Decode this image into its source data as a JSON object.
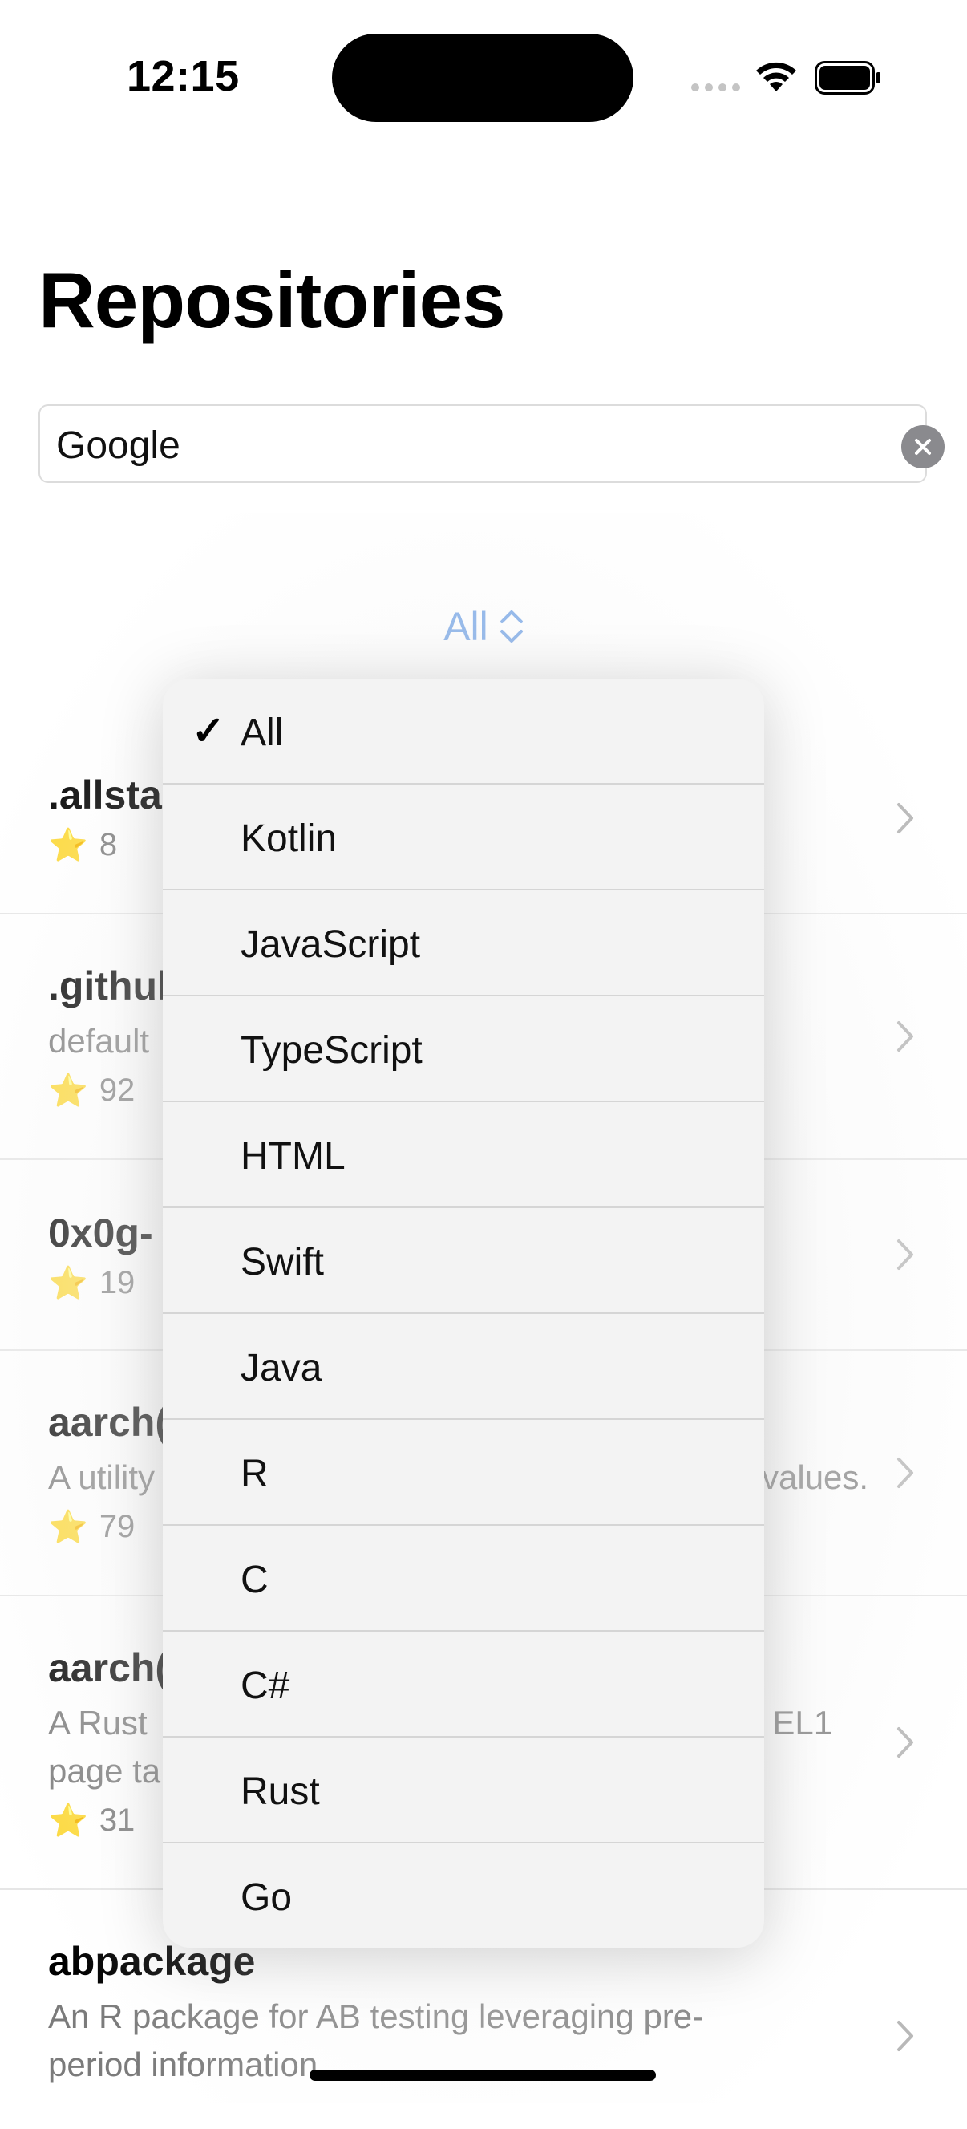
{
  "status": {
    "time": "12:15"
  },
  "page": {
    "title": "Repositories"
  },
  "search": {
    "value": "Google"
  },
  "filter": {
    "selected": "All"
  },
  "repos": [
    {
      "name": ".allsta",
      "description": "",
      "stars": "8"
    },
    {
      "name": ".githul",
      "description": "default",
      "stars": "92"
    },
    {
      "name": "0x0g-",
      "description": "",
      "stars": "19"
    },
    {
      "name": "aarch(",
      "description": "A utility",
      "description_tail": "values.",
      "stars": "79"
    },
    {
      "name": "aarch(",
      "description": "A Rust",
      "description_tail": ". EL1",
      "description_line2": "page ta",
      "stars": "31"
    },
    {
      "name": "abpackage",
      "description": "An R package for AB testing leveraging pre-",
      "description_line2": "period information"
    }
  ],
  "menu": {
    "items": [
      "All",
      "Kotlin",
      "JavaScript",
      "TypeScript",
      "HTML",
      "Swift",
      "Java",
      "R",
      "C",
      "C#",
      "Rust",
      "Go"
    ],
    "checked": "All",
    "check_glyph": "✓"
  },
  "colors": {
    "accent": "#77a6e6",
    "secondary_text": "#7b7b7b"
  }
}
